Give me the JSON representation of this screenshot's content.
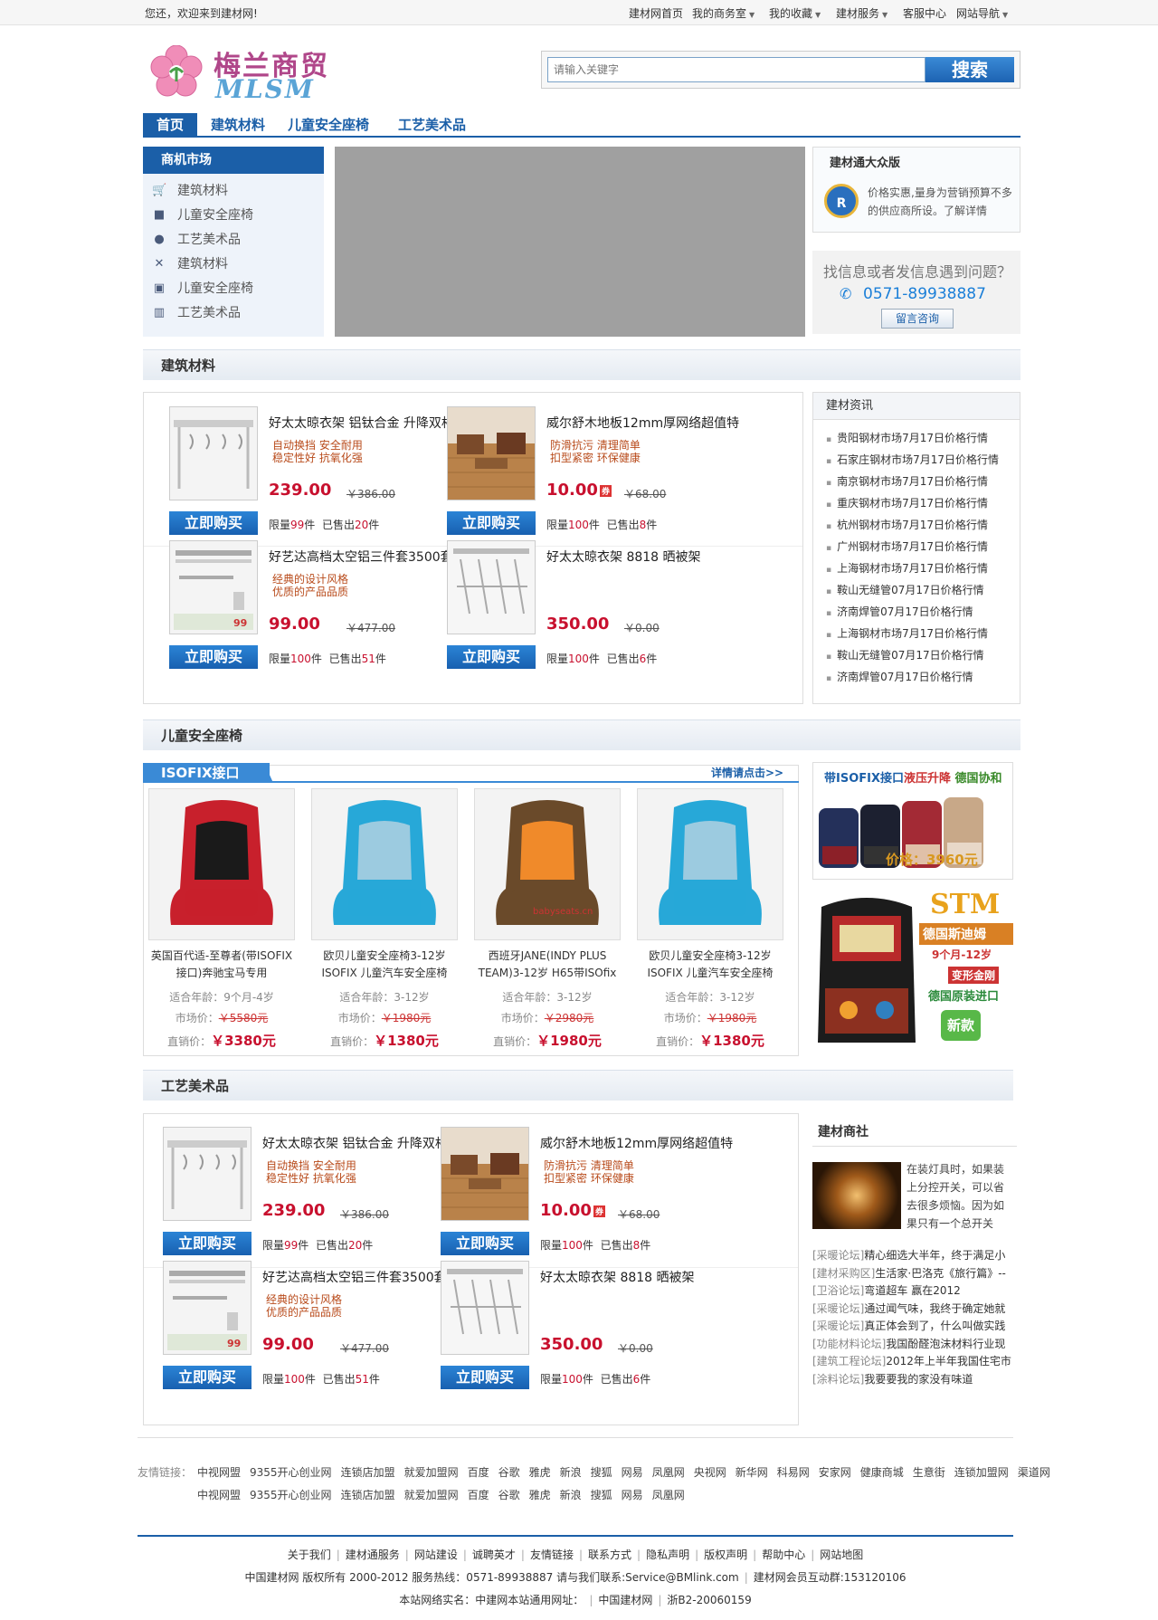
{
  "topbar": {
    "welcome": "您还，欢迎来到建材网!",
    "nav": [
      {
        "label": "建材网首页",
        "dropdown": false
      },
      {
        "label": "我的商务室",
        "dropdown": true
      },
      {
        "label": "我的收藏",
        "dropdown": true
      },
      {
        "label": "建材服务",
        "dropdown": true
      },
      {
        "label": "客服中心",
        "dropdown": false
      },
      {
        "label": "网站导航",
        "dropdown": true
      }
    ]
  },
  "header": {
    "logo_cn": "梅兰商贸",
    "logo_en": "MLSM",
    "search_placeholder": "请输入关键字",
    "search_button": "搜索"
  },
  "mainnav": [
    "首页",
    "建筑材料",
    "儿童安全座椅",
    "工艺美术品"
  ],
  "market": {
    "title": "商机市场",
    "items": [
      {
        "label": "建筑材料",
        "icon": "cart-icon"
      },
      {
        "label": "儿童安全座椅",
        "icon": "truck-icon"
      },
      {
        "label": "工艺美术品",
        "icon": "users-icon"
      },
      {
        "label": "建筑材料",
        "icon": "tools-icon"
      },
      {
        "label": "儿童安全座椅",
        "icon": "skype-icon"
      },
      {
        "label": "工艺美术品",
        "icon": "bank-icon"
      }
    ]
  },
  "mass": {
    "title": "建材通大众版",
    "badge": "大众版",
    "text": "价格实惠,量身为营销预算不多的供应商所设。了解详情"
  },
  "help": {
    "question": "找信息或者发信息遇到问题？",
    "phone": "0571-89938887",
    "button": "留言咨询"
  },
  "sections": {
    "building": "建筑材料",
    "child": "儿童安全座椅",
    "crafts": "工艺美术品"
  },
  "products": [
    {
      "name": "好太太晾衣架 铝钛合金 升降双杆",
      "tags": "自动换挡 安全耐用\n稳定性好 抗氧化强",
      "price": "239.00",
      "orig": "￥386.00",
      "buy": "立即购买",
      "limit": "99",
      "sold": "20",
      "ticket": false,
      "img": "rack"
    },
    {
      "name": "威尔舒木地板12mm厚网络超值特",
      "tags": "防滑抗污 清理简单\n扣型紧密 环保健康",
      "price": "10.00",
      "orig": "￥68.00",
      "buy": "立即购买",
      "limit": "100",
      "sold": "8",
      "ticket": true,
      "img": "floor"
    },
    {
      "name": "好艺达高档太空铝三件套3500套",
      "tags": "经典的设计风格\n优质的产品品质",
      "price": "99.00",
      "orig": "￥477.00",
      "buy": "立即购买",
      "limit": "100",
      "sold": "51",
      "ticket": false,
      "img": "towel"
    },
    {
      "name": "好太太晾衣架 8818 晒被架",
      "tags": "",
      "price": "350.00",
      "orig": "￥0.00",
      "buy": "立即购买",
      "limit": "100",
      "sold": "6",
      "ticket": false,
      "img": "rack2"
    }
  ],
  "stock_labels": {
    "limit": "限量",
    "unit": "件",
    "sold": "已售出"
  },
  "news": {
    "title": "建材资讯",
    "items": [
      "贵阳钢材市场7月17日价格行情",
      "石家庄钢材市场7月17日价格行情",
      "南京钢材市场7月17日价格行情",
      "重庆钢材市场7月17日价格行情",
      "杭州钢材市场7月17日价格行情",
      "广州钢材市场7月17日价格行情",
      "上海钢材市场7月17日价格行情",
      "鞍山无缝管07月17日价格行情",
      "济南焊管07月17日价格行情",
      "上海钢材市场7月17日价格行情",
      "鞍山无缝管07月17日价格行情",
      "济南焊管07月17日价格行情"
    ]
  },
  "isofix": {
    "tab": "ISOFIX接口",
    "detail": "详情请点击>>"
  },
  "seats": [
    {
      "name": "英国百代适-至尊者(带ISOFIX接口)奔驰宝马专用",
      "age": "9个月-4岁",
      "mkt": "￥5580元",
      "price": "￥3380元",
      "color": "red"
    },
    {
      "name": "欧贝儿童安全座椅3-12岁ISOFIX 儿童汽车安全座椅",
      "age": "3-12岁",
      "mkt": "￥1980元",
      "price": "￥1380元",
      "color": "blue"
    },
    {
      "name": "西班牙JANE(INDY PLUS TEAM)3-12岁 H65带ISOfix",
      "age": "3-12岁",
      "mkt": "￥2980元",
      "price": "￥1980元",
      "color": "brown"
    },
    {
      "name": "欧贝儿童安全座椅3-12岁ISOFIX 儿童汽车安全座椅",
      "age": "3-12岁",
      "mkt": "￥1980元",
      "price": "￥1380元",
      "color": "blue"
    }
  ],
  "seat_labels": {
    "age": "适合年龄：",
    "mkt": "市场价：",
    "price": "直销价：",
    "watermark": "babyseats.cn"
  },
  "ad1": {
    "t1": "带ISOFIX接口",
    "t2": "液压升降",
    "t3": "德国协和",
    "price": "价格：3960元"
  },
  "ad2": {
    "stm": "STM",
    "t1": "德国斯迪姆",
    "t2": "9个月-12岁",
    "t3": "变形金刚",
    "t4": "德国原装进口",
    "t5": "新款"
  },
  "mall": {
    "title": "建材商社",
    "text": "在装灯具时，如果装上分控开关，可以省去很多烦恼。因为如果只有一个总开关",
    "items": [
      {
        "tag": "[采暖论坛]",
        "text": "精心细选大半年，终于满足小"
      },
      {
        "tag": "[建材采购区]",
        "text": "生活家·巴洛克《旅行篇》--"
      },
      {
        "tag": "[卫浴论坛]",
        "text": "弯道超车 赢在2012"
      },
      {
        "tag": "[采暖论坛]",
        "text": "通过闻气味，我终于确定她就"
      },
      {
        "tag": "[采暖论坛]",
        "text": "真正体会到了，什么叫做实践"
      },
      {
        "tag": "[功能材料论坛]",
        "text": "我国酚醛泡沫材料行业现"
      },
      {
        "tag": "[建筑工程论坛]",
        "text": "2012年上半年我国住宅市"
      },
      {
        "tag": "[涂料论坛]",
        "text": "我要要我的家没有味道"
      }
    ]
  },
  "links": {
    "label": "友情链接：",
    "row1": [
      "中视网盟",
      "9355开心创业网",
      "连锁店加盟",
      "就爱加盟网",
      "百度",
      "谷歌",
      "雅虎",
      "新浪",
      "搜狐",
      "网易",
      "凤凰网",
      "央视网",
      "新华网",
      "科易网",
      "安家网",
      "健康商城",
      "生意街",
      "连锁加盟网",
      "渠道网"
    ],
    "row2": [
      "中视网盟",
      "9355开心创业网",
      "连锁店加盟",
      "就爱加盟网",
      "百度",
      "谷歌",
      "雅虎",
      "新浪",
      "搜狐",
      "网易",
      "凤凰网"
    ]
  },
  "footer": {
    "nav": [
      "关于我们",
      "建材通服务",
      "网站建设",
      "诚聘英才",
      "友情链接",
      "联系方式",
      "隐私声明",
      "版权声明",
      "帮助中心",
      "网站地图"
    ],
    "line2": "中国建材网 版权所有 2000-2012 服务热线：0571-89938887 请与我们联系:Service@BMlink.com",
    "line2b": "建材网会员互动群:153120106",
    "line3a": "本站网络实名：中建网本站通用网址：",
    "line3b": "中国建材网",
    "line3c": "浙B2-20060159"
  }
}
